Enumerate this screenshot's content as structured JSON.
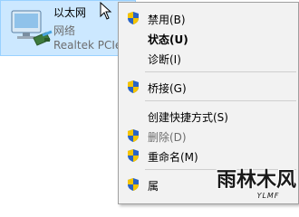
{
  "explorer_item": {
    "name": "以太网",
    "status": "网络",
    "device": "Realtek PCIe"
  },
  "context_menu": {
    "items": [
      {
        "label": "禁用(B)",
        "shield": true,
        "bold": false,
        "disabled": false
      },
      {
        "label": "状态(U)",
        "shield": false,
        "bold": true,
        "disabled": false
      },
      {
        "label": "诊断(I)",
        "shield": false,
        "bold": false,
        "disabled": false
      },
      {
        "label": "桥接(G)",
        "shield": true,
        "bold": false,
        "disabled": false
      },
      {
        "label": "创建快捷方式(S)",
        "shield": false,
        "bold": false,
        "disabled": false
      },
      {
        "label": "删除(D)",
        "shield": true,
        "bold": false,
        "disabled": true
      },
      {
        "label": "重命名(M)",
        "shield": true,
        "bold": false,
        "disabled": false
      },
      {
        "label": "属",
        "shield": true,
        "bold": false,
        "disabled": false
      }
    ]
  },
  "watermark": {
    "logo_text": "雨林木风",
    "sub_text": "YLMF"
  },
  "colors": {
    "selection_bg": "#cce8ff",
    "menu_bg": "#f2f2f2",
    "disabled_text": "#6d6d6d"
  }
}
